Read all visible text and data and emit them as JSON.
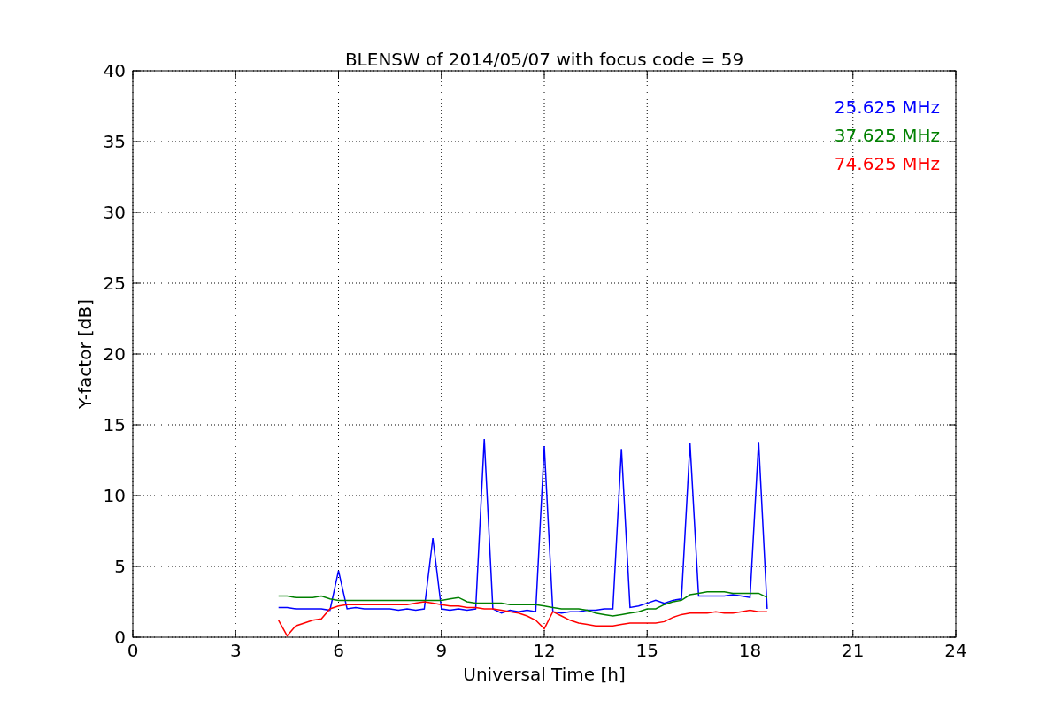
{
  "chart_data": {
    "type": "line",
    "title": "BLENSW of 2014/05/07 with focus code = 59",
    "xlabel": "Universal Time [h]",
    "ylabel": "Y-factor [dB]",
    "grid": true,
    "xlim": [
      0,
      24
    ],
    "ylim": [
      0,
      40
    ],
    "xticks": [
      0,
      3,
      6,
      9,
      12,
      15,
      18,
      21,
      24
    ],
    "yticks": [
      0,
      5,
      10,
      15,
      20,
      25,
      30,
      35,
      40
    ],
    "x": [
      4.25,
      4.5,
      4.75,
      5.0,
      5.25,
      5.5,
      5.75,
      6.0,
      6.25,
      6.5,
      6.75,
      7.0,
      7.25,
      7.5,
      7.75,
      8.0,
      8.25,
      8.5,
      8.75,
      9.0,
      9.25,
      9.5,
      9.75,
      10.0,
      10.25,
      10.5,
      10.75,
      11.0,
      11.25,
      11.5,
      11.75,
      12.0,
      12.25,
      12.5,
      12.75,
      13.0,
      13.25,
      13.5,
      13.75,
      14.0,
      14.25,
      14.5,
      14.75,
      15.0,
      15.25,
      15.5,
      15.75,
      16.0,
      16.25,
      16.5,
      16.75,
      17.0,
      17.25,
      17.5,
      17.75,
      18.0,
      18.25,
      18.5
    ],
    "series": [
      {
        "name": "25.625 MHz",
        "color": "#0000ff",
        "values": [
          2.1,
          2.1,
          2.0,
          2.0,
          2.0,
          2.0,
          1.9,
          4.7,
          2.0,
          2.1,
          2.0,
          2.0,
          2.0,
          2.0,
          1.9,
          2.0,
          1.9,
          2.0,
          7.0,
          2.0,
          1.9,
          2.0,
          1.9,
          2.0,
          14.0,
          2.0,
          1.7,
          1.9,
          1.8,
          1.9,
          1.8,
          13.5,
          1.8,
          1.7,
          1.8,
          1.8,
          1.9,
          1.9,
          2.0,
          2.0,
          13.3,
          2.1,
          2.2,
          2.4,
          2.6,
          2.4,
          2.6,
          2.7,
          13.7,
          2.9,
          2.9,
          2.9,
          2.9,
          3.0,
          2.9,
          2.8,
          13.8,
          2.0
        ]
      },
      {
        "name": "37.625 MHz",
        "color": "#008000",
        "values": [
          2.9,
          2.9,
          2.8,
          2.8,
          2.8,
          2.9,
          2.7,
          2.6,
          2.6,
          2.6,
          2.6,
          2.6,
          2.6,
          2.6,
          2.6,
          2.6,
          2.6,
          2.6,
          2.6,
          2.6,
          2.7,
          2.8,
          2.5,
          2.4,
          2.4,
          2.4,
          2.4,
          2.3,
          2.3,
          2.3,
          2.3,
          2.2,
          2.1,
          2.0,
          2.0,
          2.0,
          1.9,
          1.7,
          1.6,
          1.5,
          1.6,
          1.7,
          1.8,
          2.0,
          2.0,
          2.3,
          2.5,
          2.6,
          3.0,
          3.1,
          3.2,
          3.2,
          3.2,
          3.1,
          3.1,
          3.1,
          3.1,
          2.8
        ]
      },
      {
        "name": "74.625 MHz",
        "color": "#ff0000",
        "values": [
          1.2,
          0.1,
          0.8,
          1.0,
          1.2,
          1.3,
          2.0,
          2.2,
          2.3,
          2.3,
          2.3,
          2.3,
          2.3,
          2.3,
          2.3,
          2.3,
          2.4,
          2.5,
          2.4,
          2.3,
          2.2,
          2.2,
          2.1,
          2.1,
          2.0,
          2.0,
          1.9,
          1.8,
          1.7,
          1.5,
          1.2,
          0.6,
          1.8,
          1.5,
          1.2,
          1.0,
          0.9,
          0.8,
          0.8,
          0.8,
          0.9,
          1.0,
          1.0,
          1.0,
          1.0,
          1.1,
          1.4,
          1.6,
          1.7,
          1.7,
          1.7,
          1.8,
          1.7,
          1.7,
          1.8,
          1.9,
          1.8,
          1.8
        ]
      }
    ]
  }
}
